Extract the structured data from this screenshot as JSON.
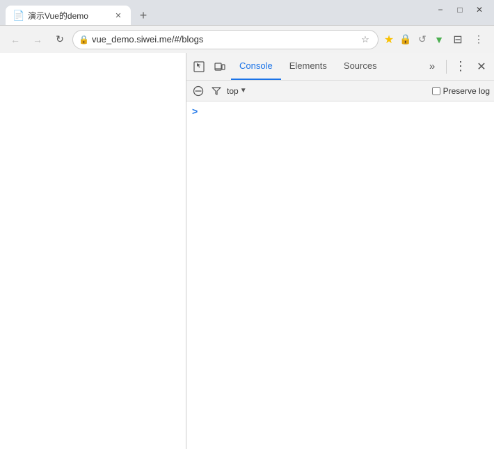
{
  "window": {
    "title": "演示Vue的demo",
    "minimize_label": "−",
    "maximize_label": "□",
    "close_label": "✕"
  },
  "tab": {
    "favicon": "📄",
    "title": "演示Vue的demo",
    "close": "✕"
  },
  "new_tab_btn": "+",
  "nav": {
    "back_btn": "←",
    "forward_btn": "→",
    "reload_btn": "↻",
    "url": "vue_demo.siwei.me/#/blogs",
    "page_icon": "🔒",
    "bookmark_btn": "☆",
    "extensions": {
      "ext1": "★",
      "ext2": "🔒",
      "ext3": "↺",
      "ext4": "▼"
    },
    "menu_btn": "⋮",
    "customize_btn": "⊟"
  },
  "devtools": {
    "inspect_btn": "⬚",
    "device_btn": "⬒",
    "tabs": [
      {
        "id": "console",
        "label": "Console",
        "active": true
      },
      {
        "id": "elements",
        "label": "Elements",
        "active": false
      },
      {
        "id": "sources",
        "label": "Sources",
        "active": false
      }
    ],
    "more_tabs_btn": "»",
    "menu_btn": "⋮",
    "close_btn": "✕",
    "console": {
      "clear_btn": "🚫",
      "filter_btn": "▽",
      "context_label": "top",
      "context_arrow": "▼",
      "preserve_log_label": "Preserve log",
      "preserve_log_checked": false,
      "prompt_arrow": ">"
    }
  }
}
